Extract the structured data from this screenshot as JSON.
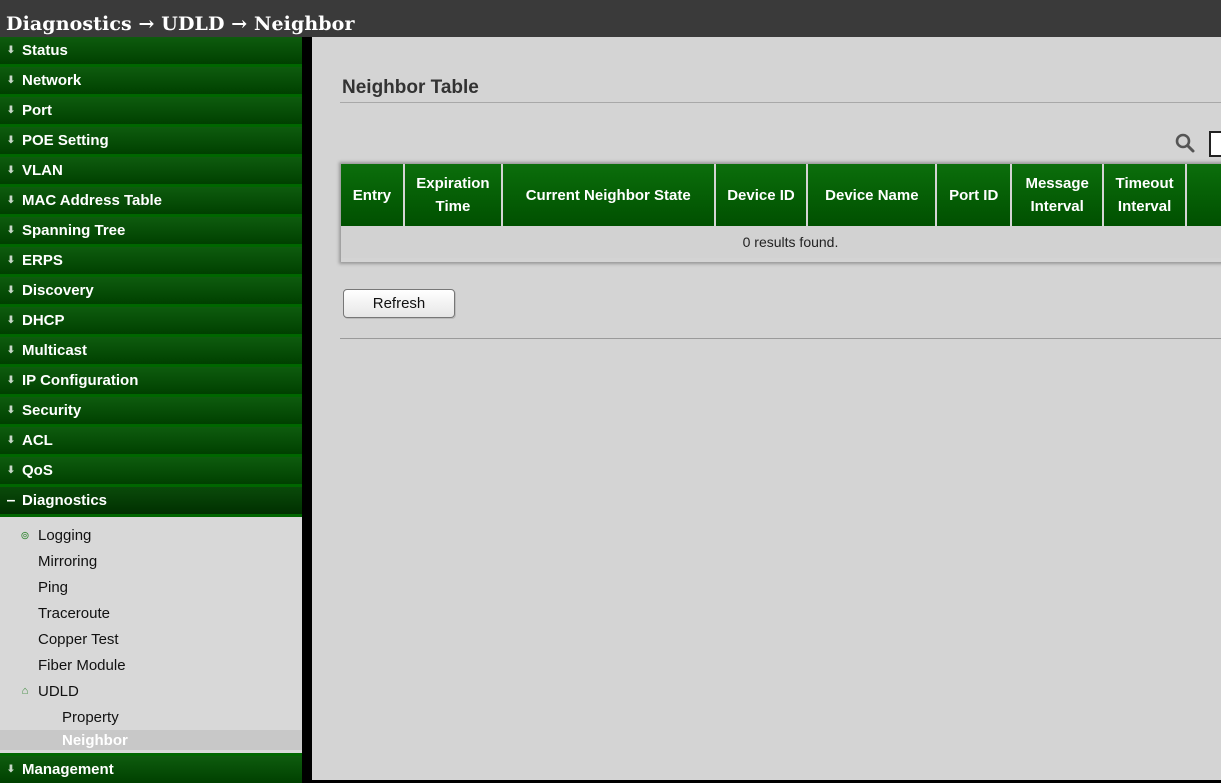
{
  "breadcrumb": "Diagnostics → UDLD → Neighbor",
  "sidebar": {
    "items_before": [
      {
        "label": "Status"
      },
      {
        "label": "Network"
      },
      {
        "label": "Port"
      },
      {
        "label": "POE Setting"
      },
      {
        "label": "VLAN"
      },
      {
        "label": "MAC Address Table"
      },
      {
        "label": "Spanning Tree"
      },
      {
        "label": "ERPS"
      },
      {
        "label": "Discovery"
      },
      {
        "label": "DHCP"
      },
      {
        "label": "Multicast"
      },
      {
        "label": "IP Configuration"
      },
      {
        "label": "Security"
      },
      {
        "label": "ACL"
      },
      {
        "label": "QoS"
      }
    ],
    "open_item": {
      "label": "Diagnostics"
    },
    "sub_items": {
      "logging": "Logging",
      "mirroring": "Mirroring",
      "ping": "Ping",
      "traceroute": "Traceroute",
      "copper_test": "Copper Test",
      "fiber_module": "Fiber Module",
      "udld": "UDLD",
      "property": "Property",
      "neighbor": "Neighbor"
    },
    "items_after": [
      {
        "label": "Management"
      }
    ]
  },
  "main": {
    "title": "Neighbor Table",
    "table": {
      "headers": {
        "entry": "Entry",
        "expiration_1": "Expiration",
        "expiration_2": "Time",
        "state": "Current Neighbor State",
        "device_id": "Device ID",
        "device_name": "Device Name",
        "port_id": "Port ID",
        "message_1": "Message",
        "message_2": "Interval",
        "timeout_1": "Timeout",
        "timeout_2": "Interval"
      },
      "empty_message": "0 results found."
    },
    "refresh_label": "Refresh"
  }
}
